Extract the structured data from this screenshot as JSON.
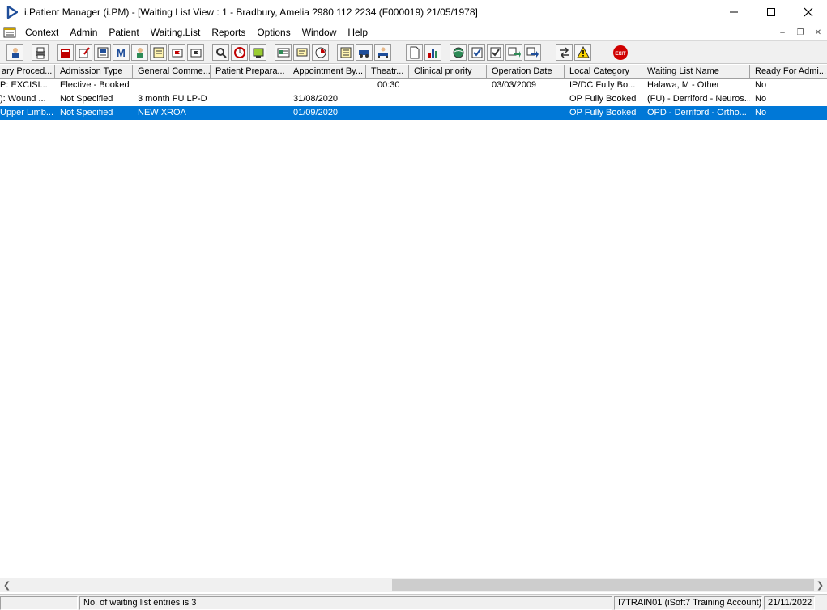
{
  "window": {
    "title": "i.Patient Manager (i.PM) - [Waiting List View :  1 - Bradbury, Amelia ?980 112 2234 (F000019) 21/05/1978]"
  },
  "menu": {
    "items": [
      "Context",
      "Admin",
      "Patient",
      "Waiting.List",
      "Reports",
      "Options",
      "Window",
      "Help"
    ]
  },
  "toolbar": {
    "buttons": [
      "patient-details-icon",
      "print-icon",
      "book-icon",
      "edit-entry-icon",
      "view-entry-icon",
      "m-letter-icon",
      "doctor-icon",
      "notes-icon",
      "flag-icon",
      "flag-alt-icon",
      "search-icon",
      "clock-icon",
      "screen-icon",
      "id-card-icon",
      "message-icon",
      "history-icon",
      "memo-icon",
      "transport-icon",
      "admit-icon",
      "document-icon",
      "chart-icon",
      "globe-icon",
      "checklist-icon",
      "checklist-alt-icon",
      "transfer-icon",
      "transfer-alt-icon",
      "swap-icon",
      "warning-icon",
      "exit-icon"
    ],
    "exit_label": "EXIT"
  },
  "grid": {
    "columns": [
      "ary Proced...",
      "Admission Type",
      "General Comme...",
      "Patient Prepara...",
      "Appointment By...",
      "Theatr...",
      "Clinical priority",
      "Operation Date",
      "Local Category",
      "Waiting List Name",
      "Ready For Admi..."
    ],
    "rows": [
      [
        "P: EXCISI...",
        "Elective - Booked",
        "",
        "",
        "",
        "00:30",
        "",
        "03/03/2009",
        "IP/DC Fully Bo...",
        "Halawa, M - Other",
        "No"
      ],
      [
        "): Wound ...",
        "Not Specified",
        "3 month FU LP-D",
        "",
        "31/08/2020",
        "",
        "",
        "",
        "OP Fully Booked",
        "(FU) - Derriford - Neuros...",
        "No"
      ],
      [
        "Upper Limb...",
        "Not Specified",
        "NEW XROA",
        "",
        "01/09/2020",
        "",
        "",
        "",
        "OP Fully Booked",
        "OPD - Derriford - Ortho...",
        "No"
      ]
    ],
    "selected_row_index": 2
  },
  "statusbar": {
    "entries_text": "No. of waiting list entries is 3",
    "account_text": "I7TRAIN01 (iSoft7 Training Account)",
    "date_text": "21/11/2022"
  },
  "colors": {
    "selection": "#0078d7",
    "title_logo": "#1f4e9a"
  }
}
